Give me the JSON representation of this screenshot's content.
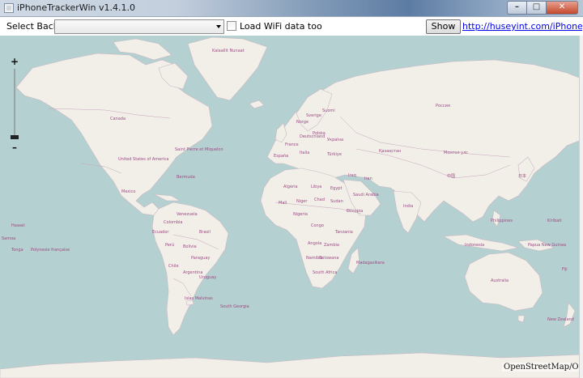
{
  "window": {
    "title": "iPhoneTrackerWin v1.4.1.0",
    "minimize_glyph": "–",
    "maximize_glyph": "□",
    "close_glyph": "✕"
  },
  "toolbar": {
    "select_backup_label": "Select Backup:",
    "select_backup_value": "",
    "wifi_label": "Load WiFi data too",
    "wifi_checked": false,
    "show_log_label": "Show Log",
    "link_text": "http://huseyint.com/iPhoneTracerkWin"
  },
  "map": {
    "zoom_in": "+",
    "zoom_out": "–",
    "attribution": "OpenStreetMap/Ope",
    "colors": {
      "water": "#b5d0d0",
      "land": "#f2efe9",
      "border": "#9c4a84"
    },
    "labels": [
      "Kalaallit Nunaat",
      "Canada",
      "United States of America",
      "Mexico",
      "Saint Pierre et Miquelon",
      "Bermuda",
      "Venezuela",
      "Colombia",
      "Ecuador",
      "Perú",
      "Brasil",
      "Bolivia",
      "Chile",
      "Argentina",
      "Paraguay",
      "Uruguay",
      "Islas Malvinas",
      "Россия",
      "Sverige",
      "Suomi",
      "Norge",
      "Deutschland",
      "France",
      "España",
      "Italia",
      "Polska",
      "Україна",
      "Türkiye",
      "Қазақстан",
      "Монгол улс",
      "中国",
      "India",
      "Iran",
      "Iraq",
      "Saudi Arabia",
      "Egypt",
      "Libya",
      "Algeria",
      "Mali",
      "Niger",
      "Chad",
      "Sudan",
      "Ethiopia",
      "Nigeria",
      "Congo",
      "Tanzania",
      "Angola",
      "Zambia",
      "Namibia",
      "Botswana",
      "South Africa",
      "Madagasikara",
      "Indonesia",
      "Australia",
      "New Zealand",
      "日本",
      "Philippines",
      "Papua New Guinea",
      "Fiji",
      "Kiribati",
      "Polynesie française",
      "Tonga",
      "Samoa",
      "Hawaii",
      "South Georgia"
    ]
  }
}
